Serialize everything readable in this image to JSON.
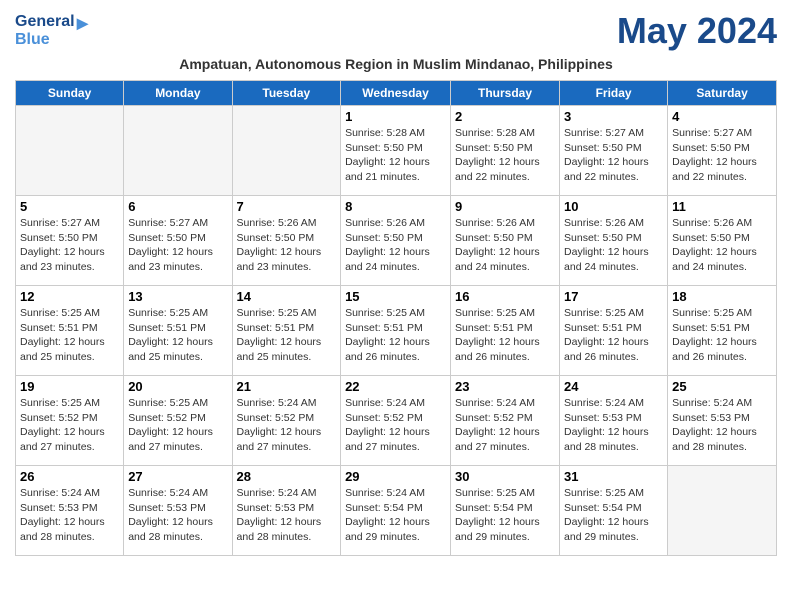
{
  "header": {
    "logo_line1": "General",
    "logo_line2": "Blue",
    "title": "May 2024",
    "subtitle": "Ampatuan, Autonomous Region in Muslim Mindanao, Philippines"
  },
  "days": [
    "Sunday",
    "Monday",
    "Tuesday",
    "Wednesday",
    "Thursday",
    "Friday",
    "Saturday"
  ],
  "weeks": [
    [
      {
        "date": "",
        "info": ""
      },
      {
        "date": "",
        "info": ""
      },
      {
        "date": "",
        "info": ""
      },
      {
        "date": "1",
        "info": "Sunrise: 5:28 AM\nSunset: 5:50 PM\nDaylight: 12 hours\nand 21 minutes."
      },
      {
        "date": "2",
        "info": "Sunrise: 5:28 AM\nSunset: 5:50 PM\nDaylight: 12 hours\nand 22 minutes."
      },
      {
        "date": "3",
        "info": "Sunrise: 5:27 AM\nSunset: 5:50 PM\nDaylight: 12 hours\nand 22 minutes."
      },
      {
        "date": "4",
        "info": "Sunrise: 5:27 AM\nSunset: 5:50 PM\nDaylight: 12 hours\nand 22 minutes."
      }
    ],
    [
      {
        "date": "5",
        "info": "Sunrise: 5:27 AM\nSunset: 5:50 PM\nDaylight: 12 hours\nand 23 minutes."
      },
      {
        "date": "6",
        "info": "Sunrise: 5:27 AM\nSunset: 5:50 PM\nDaylight: 12 hours\nand 23 minutes."
      },
      {
        "date": "7",
        "info": "Sunrise: 5:26 AM\nSunset: 5:50 PM\nDaylight: 12 hours\nand 23 minutes."
      },
      {
        "date": "8",
        "info": "Sunrise: 5:26 AM\nSunset: 5:50 PM\nDaylight: 12 hours\nand 24 minutes."
      },
      {
        "date": "9",
        "info": "Sunrise: 5:26 AM\nSunset: 5:50 PM\nDaylight: 12 hours\nand 24 minutes."
      },
      {
        "date": "10",
        "info": "Sunrise: 5:26 AM\nSunset: 5:50 PM\nDaylight: 12 hours\nand 24 minutes."
      },
      {
        "date": "11",
        "info": "Sunrise: 5:26 AM\nSunset: 5:50 PM\nDaylight: 12 hours\nand 24 minutes."
      }
    ],
    [
      {
        "date": "12",
        "info": "Sunrise: 5:25 AM\nSunset: 5:51 PM\nDaylight: 12 hours\nand 25 minutes."
      },
      {
        "date": "13",
        "info": "Sunrise: 5:25 AM\nSunset: 5:51 PM\nDaylight: 12 hours\nand 25 minutes."
      },
      {
        "date": "14",
        "info": "Sunrise: 5:25 AM\nSunset: 5:51 PM\nDaylight: 12 hours\nand 25 minutes."
      },
      {
        "date": "15",
        "info": "Sunrise: 5:25 AM\nSunset: 5:51 PM\nDaylight: 12 hours\nand 26 minutes."
      },
      {
        "date": "16",
        "info": "Sunrise: 5:25 AM\nSunset: 5:51 PM\nDaylight: 12 hours\nand 26 minutes."
      },
      {
        "date": "17",
        "info": "Sunrise: 5:25 AM\nSunset: 5:51 PM\nDaylight: 12 hours\nand 26 minutes."
      },
      {
        "date": "18",
        "info": "Sunrise: 5:25 AM\nSunset: 5:51 PM\nDaylight: 12 hours\nand 26 minutes."
      }
    ],
    [
      {
        "date": "19",
        "info": "Sunrise: 5:25 AM\nSunset: 5:52 PM\nDaylight: 12 hours\nand 27 minutes."
      },
      {
        "date": "20",
        "info": "Sunrise: 5:25 AM\nSunset: 5:52 PM\nDaylight: 12 hours\nand 27 minutes."
      },
      {
        "date": "21",
        "info": "Sunrise: 5:24 AM\nSunset: 5:52 PM\nDaylight: 12 hours\nand 27 minutes."
      },
      {
        "date": "22",
        "info": "Sunrise: 5:24 AM\nSunset: 5:52 PM\nDaylight: 12 hours\nand 27 minutes."
      },
      {
        "date": "23",
        "info": "Sunrise: 5:24 AM\nSunset: 5:52 PM\nDaylight: 12 hours\nand 27 minutes."
      },
      {
        "date": "24",
        "info": "Sunrise: 5:24 AM\nSunset: 5:53 PM\nDaylight: 12 hours\nand 28 minutes."
      },
      {
        "date": "25",
        "info": "Sunrise: 5:24 AM\nSunset: 5:53 PM\nDaylight: 12 hours\nand 28 minutes."
      }
    ],
    [
      {
        "date": "26",
        "info": "Sunrise: 5:24 AM\nSunset: 5:53 PM\nDaylight: 12 hours\nand 28 minutes."
      },
      {
        "date": "27",
        "info": "Sunrise: 5:24 AM\nSunset: 5:53 PM\nDaylight: 12 hours\nand 28 minutes."
      },
      {
        "date": "28",
        "info": "Sunrise: 5:24 AM\nSunset: 5:53 PM\nDaylight: 12 hours\nand 28 minutes."
      },
      {
        "date": "29",
        "info": "Sunrise: 5:24 AM\nSunset: 5:54 PM\nDaylight: 12 hours\nand 29 minutes."
      },
      {
        "date": "30",
        "info": "Sunrise: 5:25 AM\nSunset: 5:54 PM\nDaylight: 12 hours\nand 29 minutes."
      },
      {
        "date": "31",
        "info": "Sunrise: 5:25 AM\nSunset: 5:54 PM\nDaylight: 12 hours\nand 29 minutes."
      },
      {
        "date": "",
        "info": ""
      }
    ]
  ]
}
